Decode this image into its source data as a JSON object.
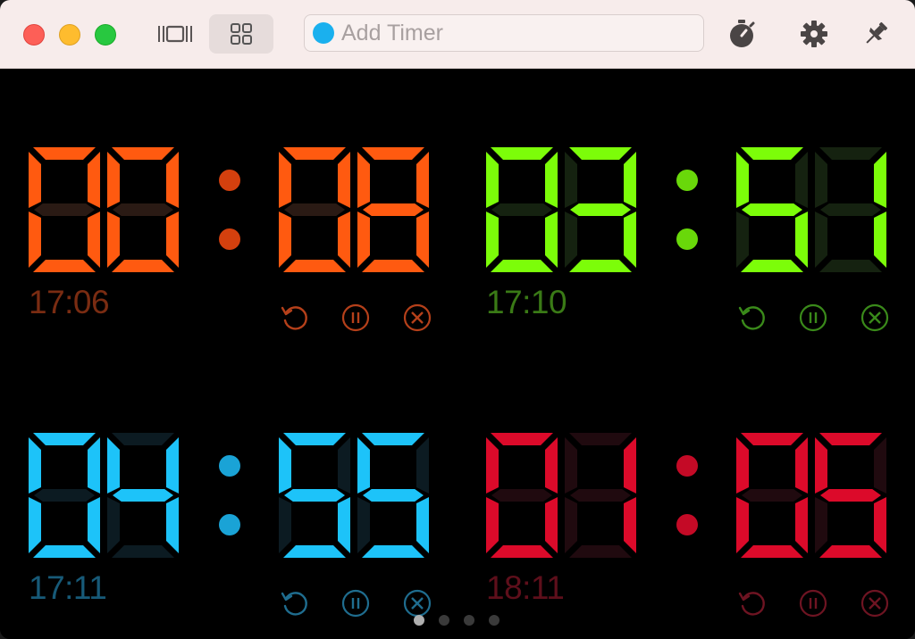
{
  "toolbar": {
    "search_placeholder": "Add Timer",
    "search_value": "",
    "search_color": "#1ab0ee",
    "icons": [
      "window-traffic-lights",
      "carousel-view-icon",
      "grid-view-icon",
      "stopwatch-icon",
      "gear-icon",
      "pin-icon"
    ]
  },
  "timers": [
    {
      "digits": "0008",
      "display": "00:08",
      "clock": "17:06",
      "color": "#ff5a10",
      "dim": "#2a1a14",
      "colon": "#d4400e",
      "label_color": "#7a2c12",
      "ctrl_color": "#b5401a"
    },
    {
      "digits": "0351",
      "display": "03:51",
      "clock": "17:10",
      "color": "#7cfd09",
      "dim": "#152210",
      "colon": "#69d80a",
      "label_color": "#3a7a16",
      "ctrl_color": "#3a8a1a"
    },
    {
      "digits": "0455",
      "display": "04:55",
      "clock": "17:11",
      "color": "#1dc3f9",
      "dim": "#0c1b22",
      "colon": "#1aa3d6",
      "label_color": "#175a78",
      "ctrl_color": "#1f6d8f"
    },
    {
      "digits": "0105",
      "display": "01:05",
      "clock": "18:11",
      "color": "#dc0a2a",
      "dim": "#200a0f",
      "colon": "#c40a26",
      "label_color": "#5e0f1b",
      "ctrl_color": "#6e1422"
    }
  ],
  "controls": [
    "reset",
    "pause",
    "remove"
  ],
  "pager": {
    "pages": 4,
    "current": 1
  }
}
